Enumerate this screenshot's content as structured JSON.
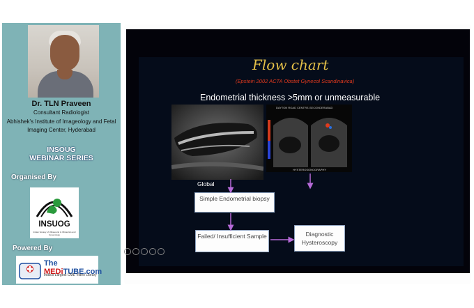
{
  "speaker": {
    "name": "Dr. TLN Praveen",
    "role": "Consultant Radiologist",
    "institution": "Abhishek's Institute of Imageology and Fetal Imaging Center, Hyderabad"
  },
  "series": {
    "line1": "INSOUG",
    "line2": "WEBINAR SERIES"
  },
  "organised_by": "Organised By",
  "insuog_logo": {
    "text": "INSUOG",
    "subtitle": "Indian Society of Ultrasound in Obstetrics and Gynecology"
  },
  "powered_by": "Powered By",
  "meditube": {
    "name_prefix": "The ",
    "name_red": "MEDi",
    "name_suffix": "TUBE.com",
    "tagline": "India's Largest CME Video Library"
  },
  "slide": {
    "title": "Flow chart",
    "citation": "(Epstein 2002 ACTA Obstet Gynecol Scandinavica)",
    "criterion": "Endometrial thickness >5mm or unmeasurable",
    "label_global": "Global",
    "box_biopsy": "Simple Endometrial biopsy",
    "box_failed": "Failed/ Insufficient Sample",
    "box_hysteroscopy": "Diagnostic Hysteroscopy",
    "us2_caption": "HYSTEROSONOGRAPHY",
    "us2_header": "DAYTON ROAD CENTRE-SECONDERABAD"
  },
  "colors": {
    "sidebar": "#7fb3b6",
    "slide_bg": "#050c1a",
    "title": "#e5c148",
    "citation": "#e23a1e",
    "arrow": "#b66ad8"
  },
  "toolbar_icons": [
    "prev-icon",
    "pen-icon",
    "zoom-icon",
    "menu-icon",
    "next-icon"
  ]
}
